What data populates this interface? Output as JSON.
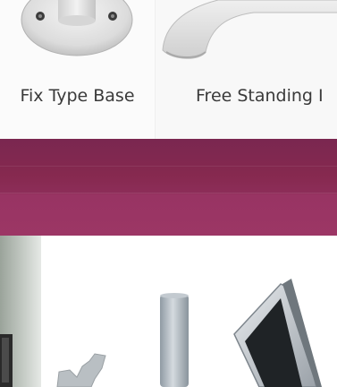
{
  "products": [
    {
      "label": "Fix Type Base",
      "image": "wall-mount-base-image"
    },
    {
      "label": "Free Standing I",
      "image": "free-standing-base-image"
    }
  ],
  "colors": {
    "band_top": "#7a2750",
    "band_bottom": "#9c3665",
    "label_text": "#3a3a3a"
  }
}
